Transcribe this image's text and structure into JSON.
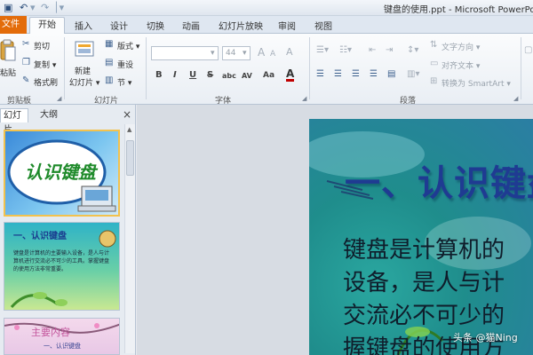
{
  "window": {
    "title": "键盘的使用.ppt - Microsoft PowerPoi"
  },
  "tabs": [
    "文件",
    "开始",
    "插入",
    "设计",
    "切换",
    "动画",
    "幻灯片放映",
    "审阅",
    "视图"
  ],
  "ribbon": {
    "clipboard": {
      "paste": "粘贴",
      "cut": "剪切",
      "copy": "复制 ▾",
      "format_painter": "格式刷",
      "group": "剪贴板"
    },
    "slides": {
      "new_slide": "新建",
      "new_slide_2": "幻灯片 ▾",
      "layout": "版式 ▾",
      "reset": "重设",
      "section": "节 ▾",
      "group": "幻灯片"
    },
    "font": {
      "name": "",
      "size": "44",
      "grow": "A",
      "shrink": "A",
      "clear": "A",
      "bold": "B",
      "italic": "I",
      "underline": "U",
      "strike": "S",
      "shadow": "abc",
      "spacing": "AV",
      "case": "Aa",
      "color": "A",
      "group": "字体"
    },
    "paragraph": {
      "text_direction": "文字方向 ▾",
      "align_text": "对齐文本 ▾",
      "smartart": "转换为 SmartArt ▾",
      "group": "段落"
    }
  },
  "panel": {
    "tab_slides": "幻灯片",
    "tab_outline": "大纲",
    "close": "×"
  },
  "thumbs": [
    {
      "title": "认识键盘"
    },
    {
      "title": "一、认识键盘",
      "body": "键盘是计算机的主要输入设备，是人与计算机进行交流必不可少的工具。掌握键盘的使用方法非常重要。"
    },
    {
      "title": "主要内容",
      "sub": "一、认识键盘"
    }
  ],
  "slide": {
    "title": "一、认识键盘",
    "lines": [
      "键盘是计算机的",
      "设备，是人与计",
      "交流必不可少的",
      "握键盘的使用方"
    ]
  },
  "watermark": "头条 @猫Ning"
}
